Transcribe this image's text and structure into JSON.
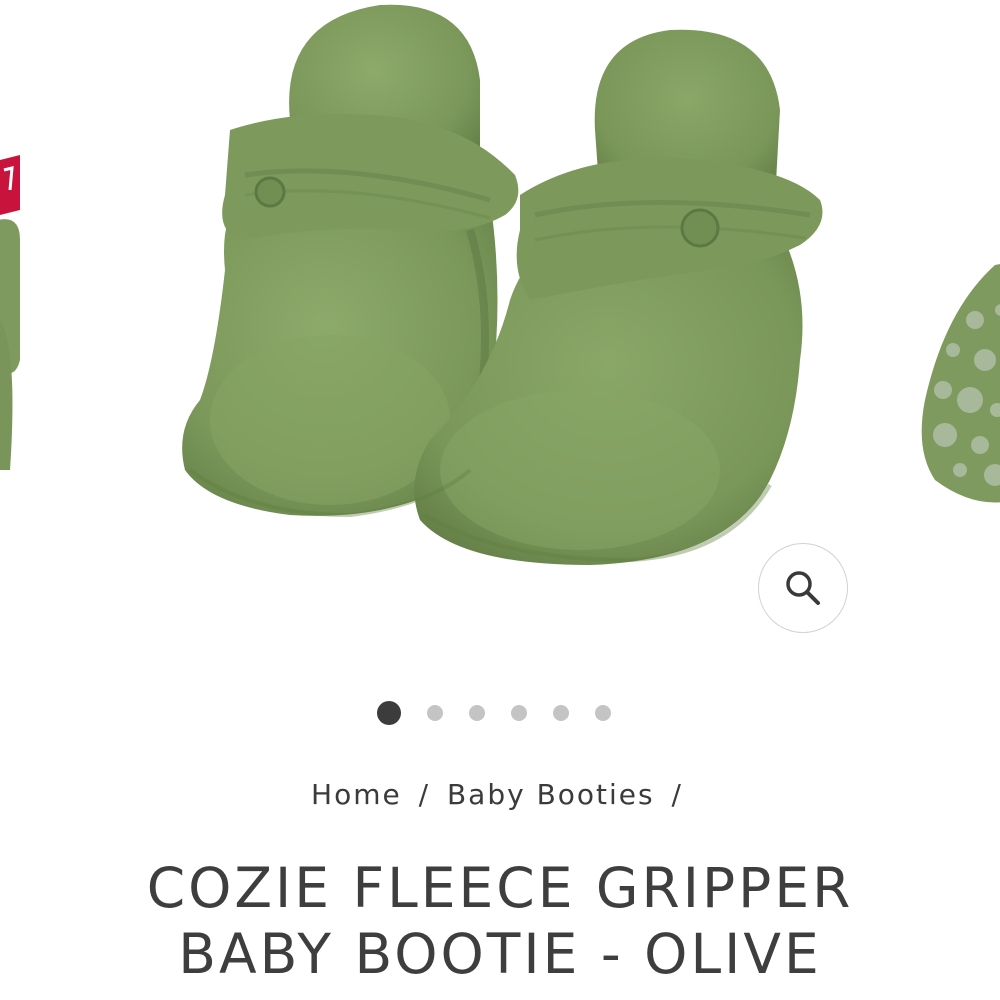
{
  "product": {
    "image_alt": "Olive fleece baby booties",
    "color": "#7e9a5e"
  },
  "gallery": {
    "slide_count": 6,
    "active_index": 0,
    "zoom_icon": "search-icon"
  },
  "breadcrumb": {
    "home": "Home",
    "category": "Baby Booties",
    "separator": "/"
  },
  "title": {
    "line1": "COZIE FLEECE GRIPPER",
    "line2": "BABY BOOTIE - OLIVE"
  },
  "colors": {
    "text": "#3d3d3d",
    "dot_active": "#3c3c3c",
    "dot_inactive": "#c4c4c4",
    "olive": "#7e9a5e",
    "olive_dark": "#5f7a45",
    "accent_red": "#c8143c"
  }
}
